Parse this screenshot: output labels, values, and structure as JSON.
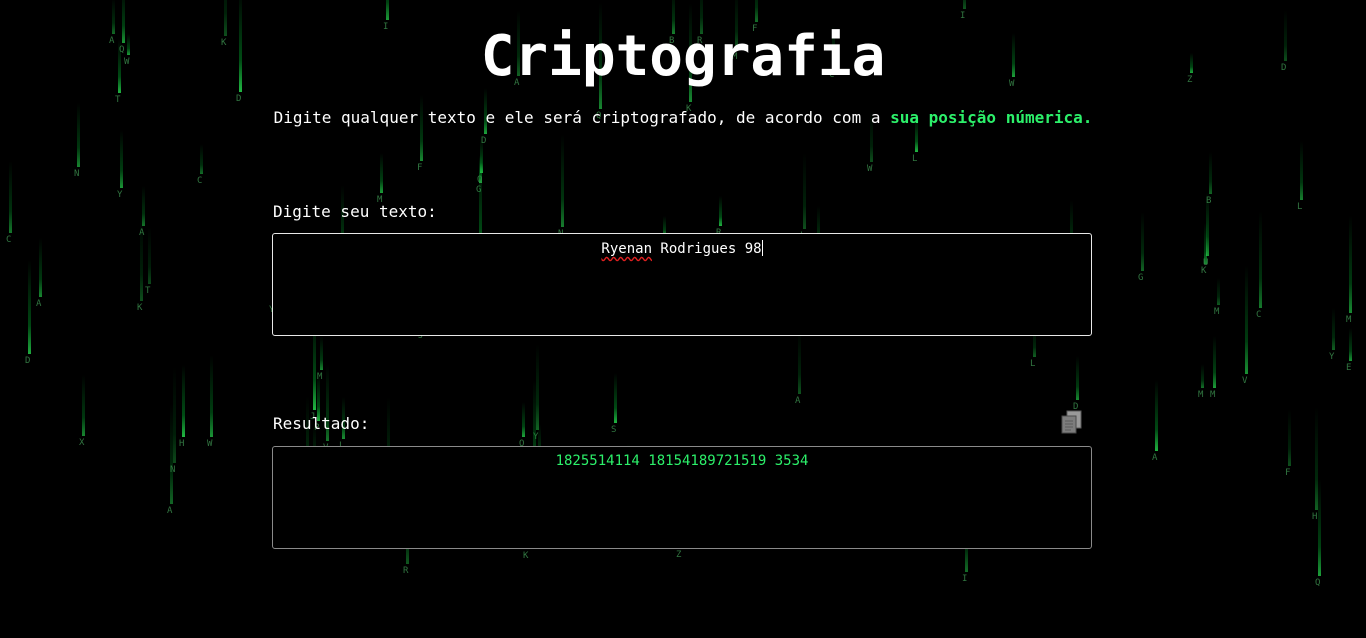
{
  "page": {
    "title": "Criptografia",
    "subtitle_prefix": "Digite qualquer texto e ele será criptografado, de acordo com a ",
    "subtitle_highlight": "sua posição númerica."
  },
  "input": {
    "label": "Digite seu texto:",
    "value_word1": "Ryenan",
    "value_rest": " Rodrigues 98"
  },
  "result": {
    "label": "Resultado:",
    "value": "1825514114 18154189721519 3534",
    "copy_icon": "copy-icon"
  },
  "colors": {
    "background": "#000000",
    "accent": "#2cf06a",
    "text": "#ffffff"
  }
}
